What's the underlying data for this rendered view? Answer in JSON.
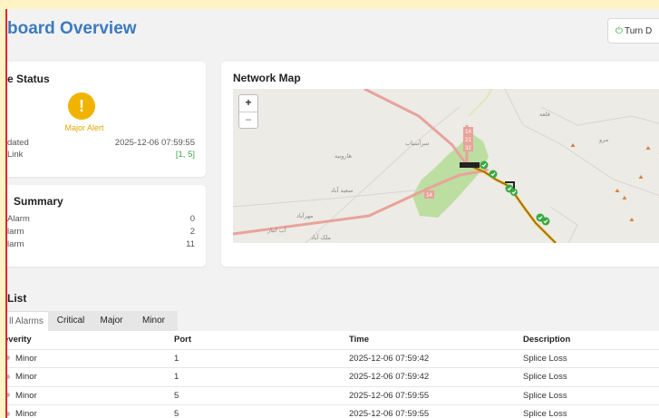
{
  "header": {
    "title": "board Overview",
    "button_label": "Turn D"
  },
  "device_status": {
    "title": "e Status",
    "alert_label": "Major Alert",
    "updated_label": "dated",
    "updated_value": "2025-12-06 07:59:55",
    "link_label": "Link",
    "link_value": "[1, 5]"
  },
  "alarm_summary": {
    "title": "Summary",
    "rows": [
      {
        "label": "Alarm",
        "value": "0"
      },
      {
        "label": "larm",
        "value": "2"
      },
      {
        "label": "larm",
        "value": "11"
      }
    ]
  },
  "network_map": {
    "title": "Network Map",
    "zoom_in": "+",
    "zoom_out": "−",
    "road_labels": [
      "14",
      "21",
      "32",
      "14"
    ],
    "place_labels": [
      "هارونيه",
      "سعيد آباد",
      "مهرآباد",
      "ملک آباد",
      "آب انبار",
      "قلعه",
      "مرو",
      "سرآسياب"
    ],
    "node_check_count": 6,
    "marker_count": 8
  },
  "alarm_list": {
    "title": "List",
    "tabs": [
      "ll Alarms",
      "Critical",
      "Major",
      "Minor"
    ],
    "active_tab": 0,
    "columns": [
      "everity",
      "Port",
      "Time",
      "Description"
    ],
    "rows": [
      {
        "severity": "Minor",
        "port": "1",
        "time": "2025-12-06 07:59:42",
        "description": "Splice Loss"
      },
      {
        "severity": "Minor",
        "port": "1",
        "time": "2025-12-06 07:59:42",
        "description": "Splice Loss"
      },
      {
        "severity": "Minor",
        "port": "5",
        "time": "2025-12-06 07:59:55",
        "description": "Splice Loss"
      },
      {
        "severity": "Minor",
        "port": "5",
        "time": "2025-12-06 07:59:55",
        "description": "Splice Loss"
      }
    ]
  },
  "colors": {
    "accent": "#3b7bbf",
    "major": "#f0b400",
    "ok": "#3aa845",
    "route": "#f0a800",
    "park": "#b9df9a"
  }
}
